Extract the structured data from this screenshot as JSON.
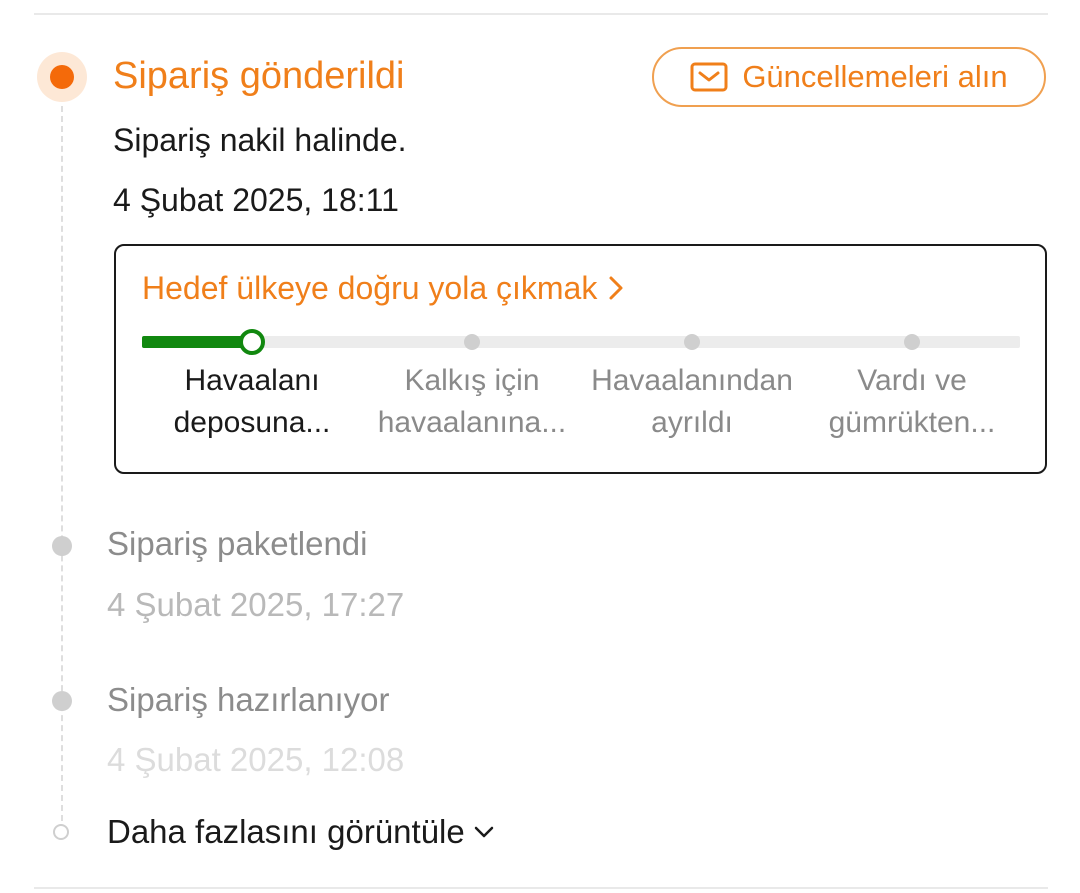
{
  "current_status": {
    "title": "Sipariş gönderildi",
    "description": "Sipariş nakil halinde.",
    "date": "4 Şubat 2025, 18:11",
    "subscribe_button": {
      "label": "Güncellemeleri alın",
      "icon": "mail-icon"
    }
  },
  "shipping_card": {
    "link_label": "Hedef ülkeye doğru yola çıkmak",
    "link_icon": "chevron-right-icon",
    "progress_fraction": 0.125,
    "current_step_index": 0,
    "steps": [
      {
        "label": "Havaalanı deposuna..."
      },
      {
        "label": "Kalkış için havaalanına..."
      },
      {
        "label": "Havaalanından ayrıldı"
      },
      {
        "label": "Vardı ve gümrükten..."
      }
    ],
    "colors": {
      "progress": "#11880f",
      "track": "#ececec",
      "pending_node": "#cfcfcf"
    }
  },
  "history": [
    {
      "title": "Sipariş paketlendi",
      "date": "4 Şubat 2025, 17:27"
    },
    {
      "title": "Sipariş hazırlanıyor",
      "date": "4 Şubat 2025, 12:08"
    }
  ],
  "show_more": {
    "label": "Daha fazlasını görüntüle",
    "icon": "chevron-down-icon"
  },
  "colors": {
    "accent": "#f07f1a",
    "active_dot": "#f46a0a",
    "muted_text": "#8c8c8c"
  }
}
